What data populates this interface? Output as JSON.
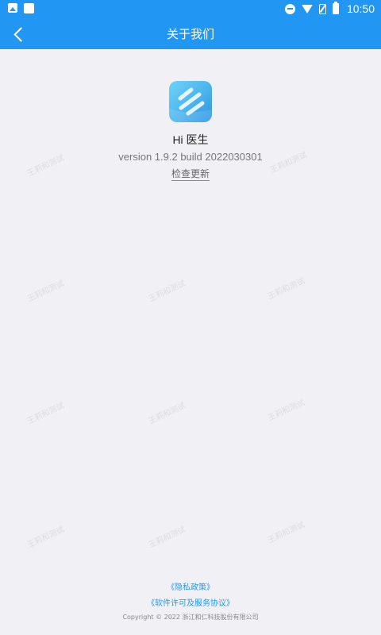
{
  "status_bar": {
    "time": "10:50",
    "icons": [
      "image-icon",
      "square-icon",
      "dnd-icon",
      "wifi-icon",
      "no-sim-icon",
      "battery-icon"
    ]
  },
  "header": {
    "title": "关于我们",
    "back_icon": "chevron-left-icon"
  },
  "app": {
    "name": "Hi 医生",
    "version": "version 1.9.2 build 2022030301",
    "check_update_label": "检查更新",
    "logo_icon": "app-logo-icon"
  },
  "footer": {
    "privacy_label": "《隐私政策》",
    "license_label": "《软件许可及服务协议》",
    "copyright": "Copyright © 2022 浙江和仁科技股份有限公司"
  },
  "watermark": {
    "text": "王莉和测试"
  },
  "colors": {
    "primary": "#2196f3",
    "background": "#f1f1f5",
    "link": "#2196f3"
  }
}
